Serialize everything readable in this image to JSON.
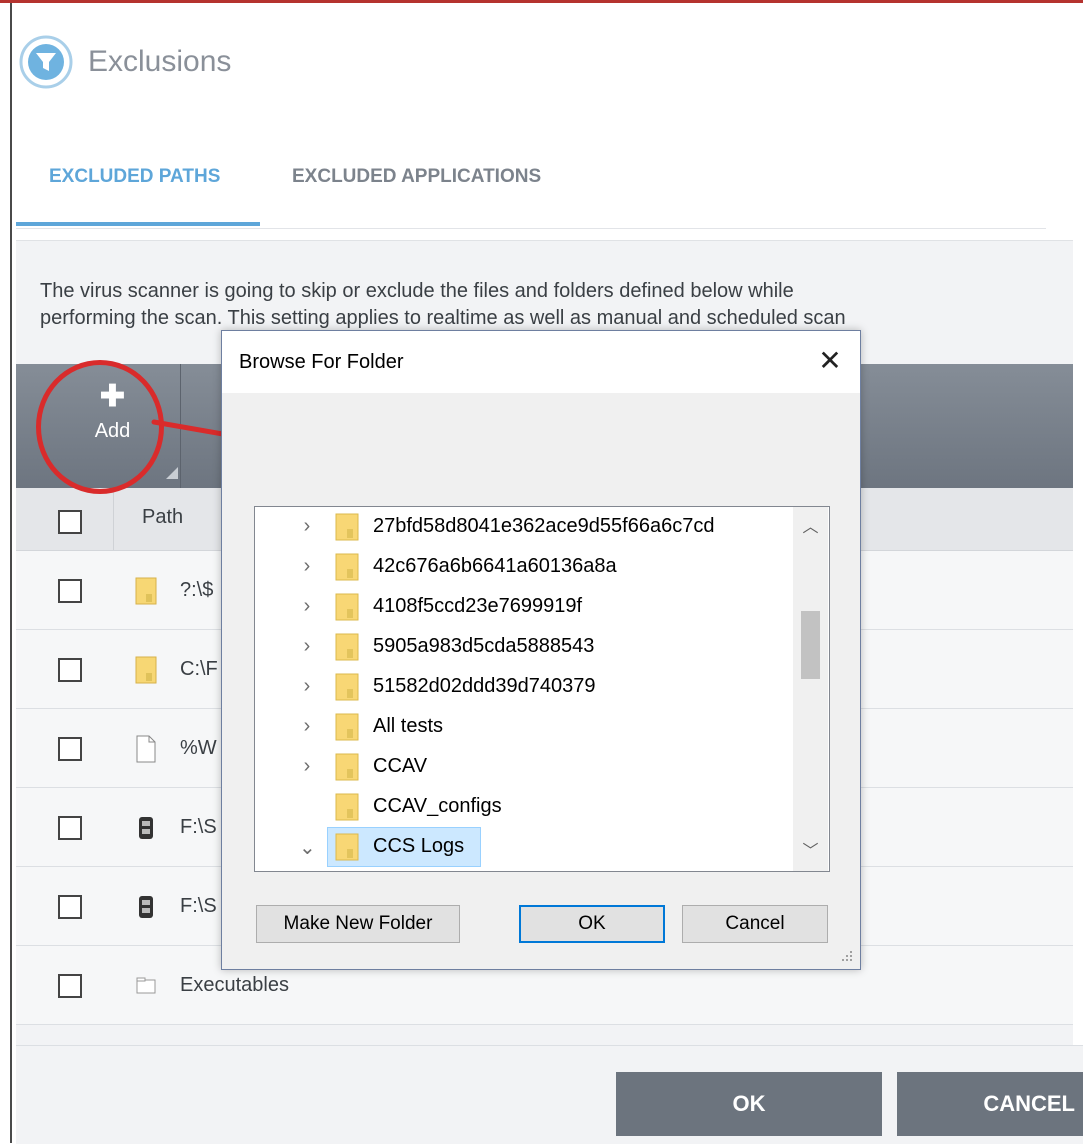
{
  "colors": {
    "accent": "#5ea6d9",
    "toolbar": "#7a828c",
    "annotation": "#d92b2b",
    "dialog_ok_border": "#0078d7"
  },
  "header": {
    "title": "Exclusions",
    "icon": "filter-shield-icon"
  },
  "tabs": [
    {
      "label": "EXCLUDED PATHS",
      "active": true
    },
    {
      "label": "EXCLUDED APPLICATIONS",
      "active": false
    }
  ],
  "description": [
    "The virus scanner is going to skip or exclude the files and folders defined below while",
    "performing the scan. This setting applies to realtime as well as manual and scheduled scan"
  ],
  "toolbar": {
    "add_label": "Add",
    "add_icon": "plus-icon"
  },
  "table": {
    "column_path": "Path",
    "rows": [
      {
        "icon": "folder-icon",
        "text": "?:\\$"
      },
      {
        "icon": "folder-icon",
        "text": "C:\\F"
      },
      {
        "icon": "file-icon",
        "text": "%W"
      },
      {
        "icon": "program-icon",
        "text": "F:\\S"
      },
      {
        "icon": "program-icon",
        "text": "F:\\S"
      },
      {
        "icon": "group-icon",
        "text": "Executables"
      }
    ]
  },
  "footer": {
    "ok_label": "OK",
    "cancel_label": "CANCEL"
  },
  "dialog": {
    "title": "Browse For Folder",
    "close_glyph": "✕",
    "folders": [
      {
        "name": "27bfd58d8041e362ace9d55f66a6c7cd",
        "expander": "collapsed"
      },
      {
        "name": "42c676a6b6641a60136a8a",
        "expander": "collapsed"
      },
      {
        "name": "4108f5ccd23e7699919f",
        "expander": "collapsed"
      },
      {
        "name": "5905a983d5cda5888543",
        "expander": "collapsed"
      },
      {
        "name": "51582d02ddd39d740379",
        "expander": "collapsed"
      },
      {
        "name": "All tests",
        "expander": "collapsed"
      },
      {
        "name": "CCAV",
        "expander": "collapsed"
      },
      {
        "name": "CCAV_configs",
        "expander": "none"
      },
      {
        "name": "CCS Logs",
        "expander": "expanded",
        "selected": true
      }
    ],
    "make_new_folder_label": "Make New Folder",
    "ok_label": "OK",
    "cancel_label": "Cancel"
  }
}
